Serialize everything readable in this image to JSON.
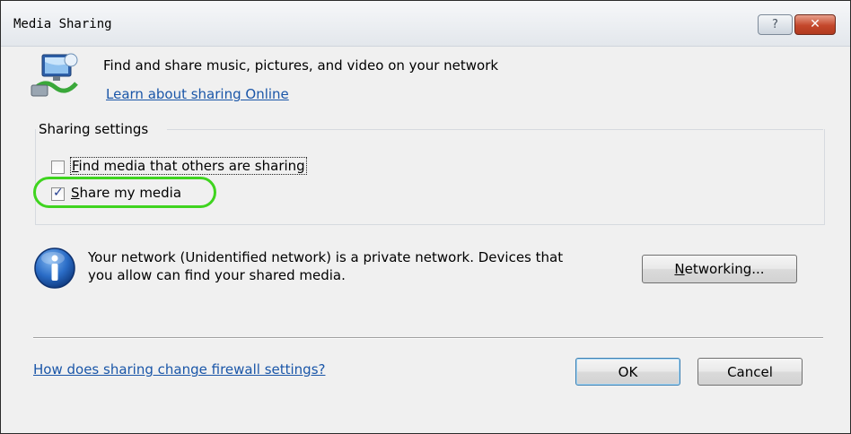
{
  "window": {
    "title": "Media Sharing",
    "help_label": "?",
    "close_label": "✕"
  },
  "header": {
    "text": "Find and share music, pictures, and video on your network",
    "link": "Learn about sharing Online"
  },
  "sharing_settings": {
    "label": "Sharing settings",
    "find_media": {
      "accel": "F",
      "rest": "ind media that others are sharing",
      "checked": false
    },
    "share_media": {
      "accel": "S",
      "rest": "hare my media",
      "checked": true
    }
  },
  "network_info": {
    "line1": "Your network (Unidentified network) is a private network. Devices that",
    "line2": "you allow can find your shared media."
  },
  "buttons": {
    "networking_accel": "N",
    "networking_rest": "etworking...",
    "ok": "OK",
    "cancel": "Cancel"
  },
  "footer": {
    "link": "How does sharing change firewall settings?"
  },
  "colors": {
    "link": "#1a56a8",
    "highlight": "#3fd41f",
    "close_button": "#c4472b"
  },
  "icons": [
    "media-sharing-icon",
    "info-icon",
    "help-icon",
    "close-icon",
    "checkmark-icon"
  ]
}
